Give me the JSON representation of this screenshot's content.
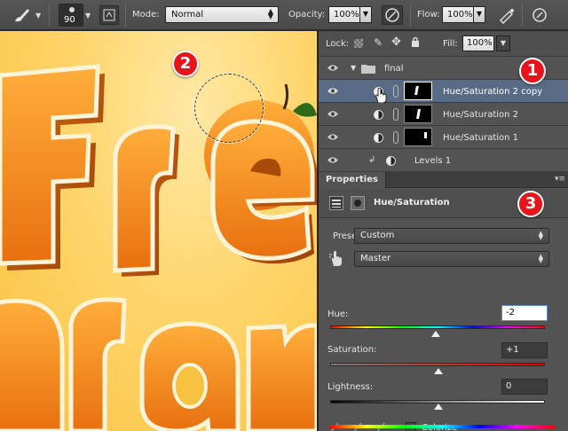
{
  "options_bar": {
    "brush_size": "90",
    "mode_label": "Mode:",
    "mode_value": "Normal",
    "opacity_label": "Opacity:",
    "opacity_value": "100%",
    "flow_label": "Flow:",
    "flow_value": "100%"
  },
  "layers_panel": {
    "lock_label": "Lock:",
    "fill_label": "Fill:",
    "fill_value": "100%",
    "layers": [
      {
        "name": "final",
        "kind": "group"
      },
      {
        "name": "Hue/Saturation 2 copy",
        "kind": "adjustment",
        "selected": true
      },
      {
        "name": "Hue/Saturation 2",
        "kind": "adjustment"
      },
      {
        "name": "Hue/Saturation 1",
        "kind": "adjustment"
      },
      {
        "name": "Levels 1",
        "kind": "adjustment-clipped"
      }
    ]
  },
  "properties_panel": {
    "tab_label": "Properties",
    "title": "Hue/Saturation",
    "preset_label": "Preset:",
    "preset_value": "Custom",
    "channel_value": "Master",
    "hue_label": "Hue:",
    "hue_value": "-2",
    "saturation_label": "Saturation:",
    "saturation_value": "+1",
    "lightness_label": "Lightness:",
    "lightness_value": "0",
    "colorize_label": "Colorize"
  },
  "canvas": {
    "artwork_letters": [
      "F",
      "r",
      "e",
      "b",
      "r",
      "a",
      "n"
    ]
  },
  "annotations": {
    "badge_1": "1",
    "badge_2": "2",
    "badge_3": "3"
  },
  "colors": {
    "accent_red": "#e8141a",
    "selected_layer": "#596b84",
    "panel_bg": "#535353",
    "orange": "#f28a1a"
  }
}
